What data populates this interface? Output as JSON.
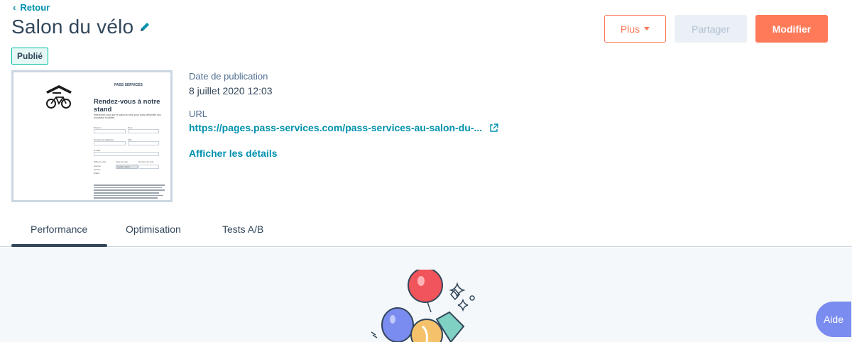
{
  "nav": {
    "back_label": "Retour"
  },
  "header": {
    "title": "Salon du vélo",
    "actions": {
      "more_label": "Plus",
      "share_label": "Partager",
      "edit_label": "Modifier"
    }
  },
  "status": {
    "badge": "Publié"
  },
  "preview": {
    "brand_a": "PASS",
    "brand_b": "SERVICES",
    "headline": "Rendez-vous à notre stand",
    "subtext": "Retrouvez-nous sur le salon du vélo pour vous présenter nos nouveaux modèles",
    "fields": [
      "Prénom",
      "Nom",
      "Numéro de téléphone",
      "Ville",
      "E-mail*",
      "Taille du vélo",
      "Type de vélo",
      "Numéro de vélo"
    ],
    "select_value": "Veuillez sélect",
    "radios": [
      "Homme",
      "Femme",
      "Enfant"
    ]
  },
  "details": {
    "publish_label": "Date de publication",
    "publish_value": "8 juillet 2020 12:03",
    "url_label": "URL",
    "url_value": "https://pages.pass-services.com/pass-services-au-salon-du-...",
    "details_link": "Afficher les détails"
  },
  "tabs": [
    {
      "label": "Performance",
      "active": true
    },
    {
      "label": "Optimisation",
      "active": false
    },
    {
      "label": "Tests A/B",
      "active": false
    }
  ],
  "help": {
    "label": "Aide"
  },
  "colors": {
    "accent": "#ff7a59",
    "link": "#0091ae",
    "badge_border": "#00bda5",
    "help_bg": "#7b8cf0"
  }
}
